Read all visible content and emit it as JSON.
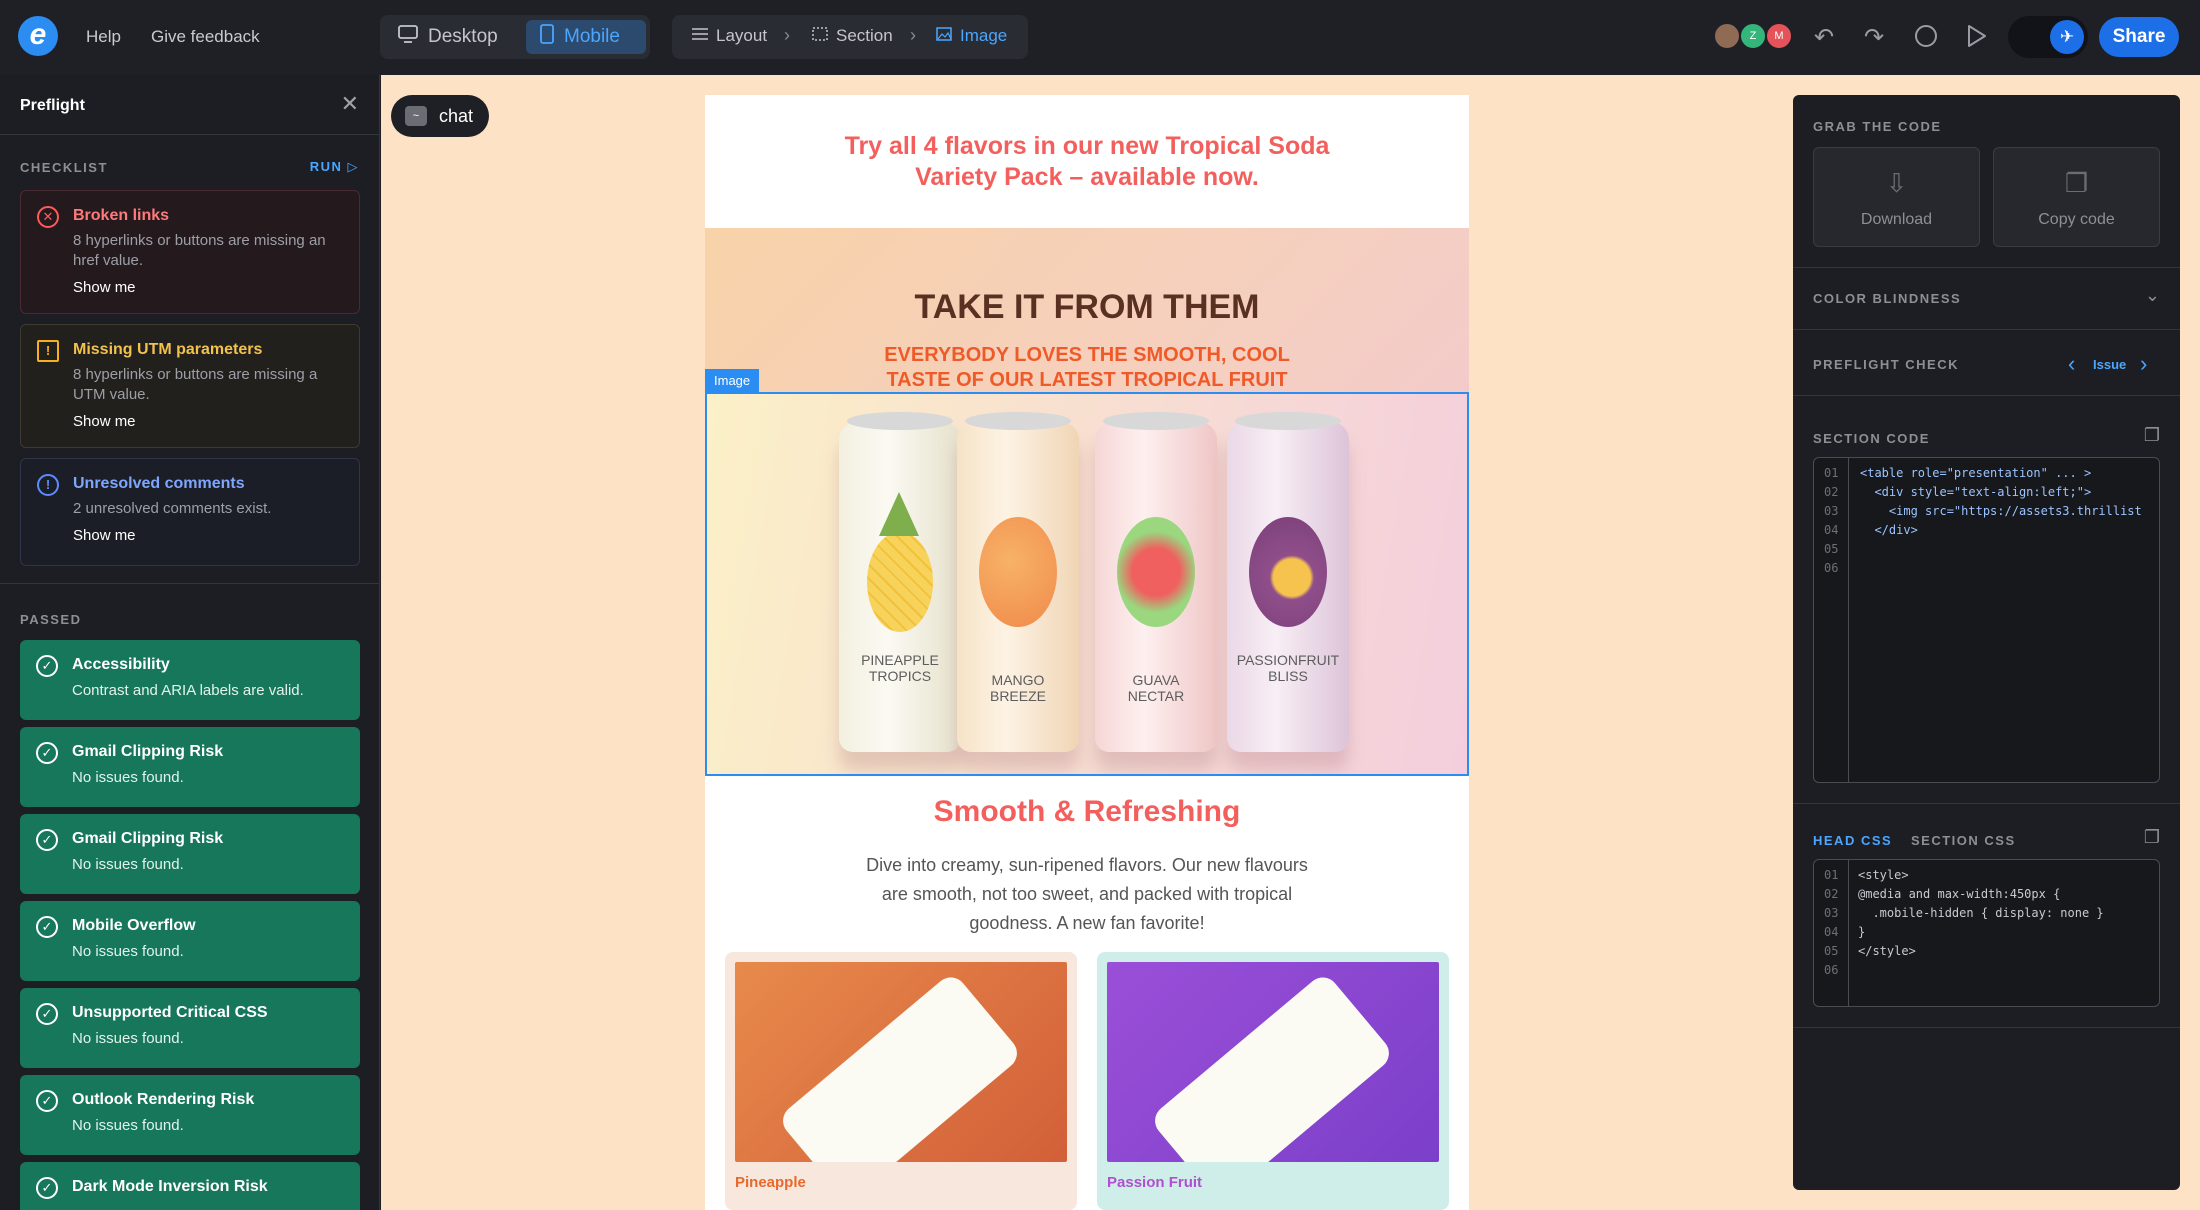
{
  "topbar": {
    "help": "Help",
    "feedback": "Give feedback",
    "view_desktop": "Desktop",
    "view_mobile": "Mobile",
    "crumb_layout": "Layout",
    "crumb_section": "Section",
    "crumb_image": "Image",
    "avatars": [
      "Z",
      "M"
    ],
    "share": "Share"
  },
  "preflight": {
    "title": "Preflight",
    "checklist_label": "CHECKLIST",
    "run_label": "RUN",
    "issues": [
      {
        "title": "Broken links",
        "desc": "8 hyperlinks or buttons are missing an href value.",
        "action": "Show me"
      },
      {
        "title": "Missing UTM parameters",
        "desc": "8 hyperlinks or buttons are missing a UTM value.",
        "action": "Show me"
      },
      {
        "title": "Unresolved comments",
        "desc": "2 unresolved comments exist.",
        "action": "Show me"
      }
    ],
    "passed_label": "PASSED",
    "passed": [
      {
        "title": "Accessibility",
        "desc": "Contrast and ARIA labels are valid."
      },
      {
        "title": "Gmail Clipping Risk",
        "desc": "No issues found."
      },
      {
        "title": "Gmail Clipping Risk",
        "desc": "No issues found."
      },
      {
        "title": "Mobile Overflow",
        "desc": "No issues found."
      },
      {
        "title": "Unsupported Critical CSS",
        "desc": "No issues found."
      },
      {
        "title": "Outlook Rendering Risk",
        "desc": "No issues found."
      },
      {
        "title": "Dark Mode Inversion Risk",
        "desc": ""
      }
    ]
  },
  "canvas": {
    "chat_label": "chat",
    "email": {
      "header": "Try all 4 flavors in our new Tropical Soda Variety Pack – available now.",
      "hero_title": "TAKE IT FROM THEM",
      "hero_sub": "EVERYBODY LOVES THE SMOOTH, COOL TASTE OF OUR LATEST TROPICAL FRUIT SODA’S",
      "image_tag": "Image",
      "cans": [
        {
          "label": "PINEAPPLE TROPICS"
        },
        {
          "label": "MANGO BREEZE"
        },
        {
          "label": "GUAVA NECTAR"
        },
        {
          "label": "PASSIONFRUIT BLISS"
        }
      ],
      "h2": "Smooth & Refreshing",
      "body": "Dive into creamy, sun-ripened flavors. Our new flavours are smooth, not too sweet, and packed with tropical goodness. A new fan favorite!",
      "products": [
        {
          "name": "Pineapple"
        },
        {
          "name": "Passion Fruit"
        }
      ]
    }
  },
  "right_panel": {
    "grab_code": "GRAB THE CODE",
    "download": "Download",
    "copy_code": "Copy code",
    "color_blindness": "COLOR BLINDNESS",
    "preflight_check": "PREFLIGHT CHECK",
    "issue_label": "Issue",
    "section_code": "SECTION CODE",
    "section_code_lines": [
      {
        "n": "01",
        "text": "<table role=\"presentation\" ... >"
      },
      {
        "n": "02",
        "text": "  <div style=\"text-align:left;\">"
      },
      {
        "n": "03",
        "text": "    <img src=\"https://assets3.thrillist"
      },
      {
        "n": "04",
        "text": "  </div>"
      },
      {
        "n": "05",
        "text": ""
      },
      {
        "n": "06",
        "text": ""
      }
    ],
    "head_css_tab": "HEAD CSS",
    "section_css_tab": "SECTION CSS",
    "css_lines": [
      {
        "n": "01",
        "text": "<style>"
      },
      {
        "n": "02",
        "text": "@media and max-width:450px {"
      },
      {
        "n": "03",
        "text": "  .mobile-hidden { display: none }"
      },
      {
        "n": "04",
        "text": "}"
      },
      {
        "n": "05",
        "text": "</style>"
      },
      {
        "n": "06",
        "text": ""
      }
    ]
  }
}
